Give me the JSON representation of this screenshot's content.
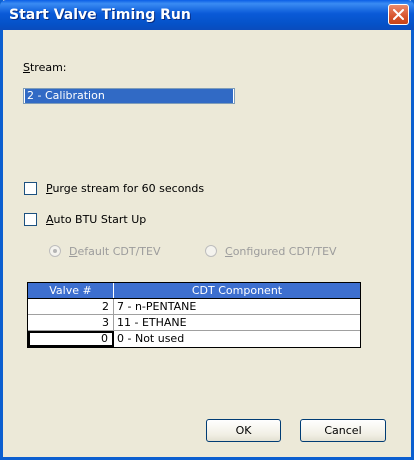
{
  "window": {
    "title": "Start Valve Timing Run"
  },
  "stream": {
    "label_accel": "S",
    "label_rest": "tream:",
    "selected": "2 - Calibration"
  },
  "options": {
    "purge": {
      "accel": "P",
      "rest": "urge stream for 60 seconds",
      "checked": false
    },
    "auto_btu": {
      "accel": "A",
      "rest": "uto BTU Start Up",
      "checked": false
    }
  },
  "cdt": {
    "default": {
      "accel": "D",
      "rest": "efault CDT/TEV",
      "selected": true,
      "enabled": false
    },
    "configured": {
      "accel": "C",
      "rest": "onfigured CDT/TEV",
      "selected": false,
      "enabled": false
    }
  },
  "grid": {
    "headers": {
      "valve": "Valve #",
      "component": "CDT Component"
    },
    "rows": [
      {
        "valve": "2",
        "component": "7 - n-PENTANE"
      },
      {
        "valve": "3",
        "component": "11 - ETHANE"
      },
      {
        "valve": "0",
        "component": "0 - Not used"
      }
    ]
  },
  "buttons": {
    "ok": "OK",
    "cancel": "Cancel"
  },
  "colors": {
    "title_bar": "#0a5ad8",
    "selection": "#316ac5",
    "grid_header": "#3d6fcf",
    "dialog_bg": "#ece9d8"
  }
}
